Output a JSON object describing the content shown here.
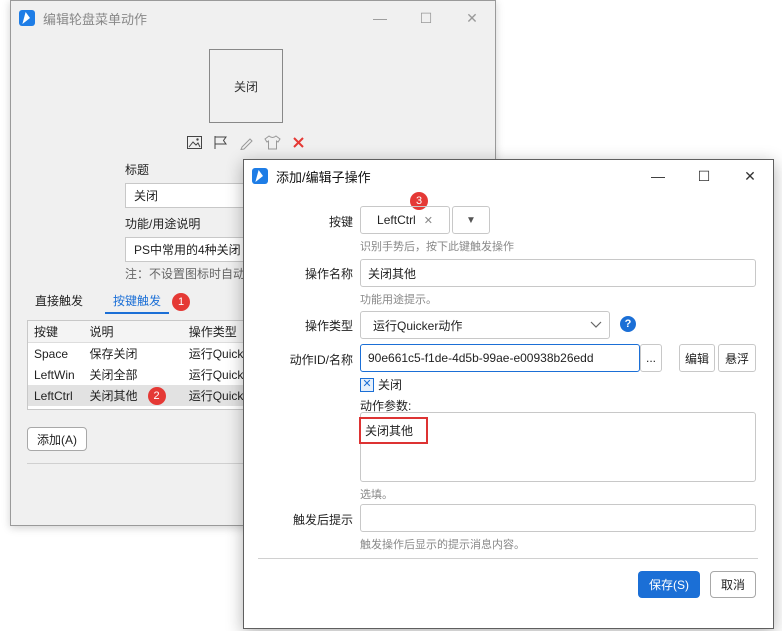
{
  "back_window": {
    "title": "编辑轮盘菜单动作",
    "preview_text": "关闭",
    "title_label": "标题",
    "title_value": "关闭",
    "desc_label": "功能/用途说明",
    "desc_value": "PS中常用的4种关闭",
    "note": "注：不设置图标时自动",
    "tabs": [
      "直接触发",
      "按键触发"
    ],
    "tab_badge": "1",
    "table": {
      "headers": [
        "按键",
        "说明",
        "操作类型"
      ],
      "rows": [
        [
          "Space",
          "保存关闭",
          "运行Quick"
        ],
        [
          "LeftWin",
          "关闭全部",
          "运行Quick"
        ],
        [
          "LeftCtrl",
          "关闭其他",
          "运行Quick"
        ]
      ],
      "row_badge": "2"
    },
    "add_button": "添加(A)",
    "win_buttons": {
      "min": "—",
      "max": "☐",
      "close": "✕"
    }
  },
  "dialog": {
    "title": "添加/编辑子操作",
    "key_label": "按键",
    "key_value": "LeftCtrl",
    "key_badge": "3",
    "key_hint": "识别手势后，按下此键触发操作",
    "name_label": "操作名称",
    "name_value": "关闭其他",
    "name_hint": "功能用途提示。",
    "type_label": "操作类型",
    "type_value": "运行Quicker动作",
    "action_label": "动作ID/名称",
    "action_value": "90e661c5-f1de-4d5b-99ae-e00938b26edd",
    "more_button": "...",
    "edit_button": "编辑",
    "float_button": "悬浮",
    "checkbox_label": "关闭",
    "params_label": "动作参数:",
    "params_value": "关闭其他",
    "params_hint": "选填。",
    "after_label": "触发后提示",
    "after_value": "",
    "after_hint": "触发操作后显示的提示消息内容。",
    "save_button": "保存(S)",
    "cancel_button": "取消",
    "win_buttons": {
      "min": "—",
      "max": "☐",
      "close": "✕"
    }
  },
  "colors": {
    "accent": "#1b6fd6",
    "badge": "#e53935",
    "highlight": "#dd3333",
    "app_icon": "#1e7de6"
  }
}
